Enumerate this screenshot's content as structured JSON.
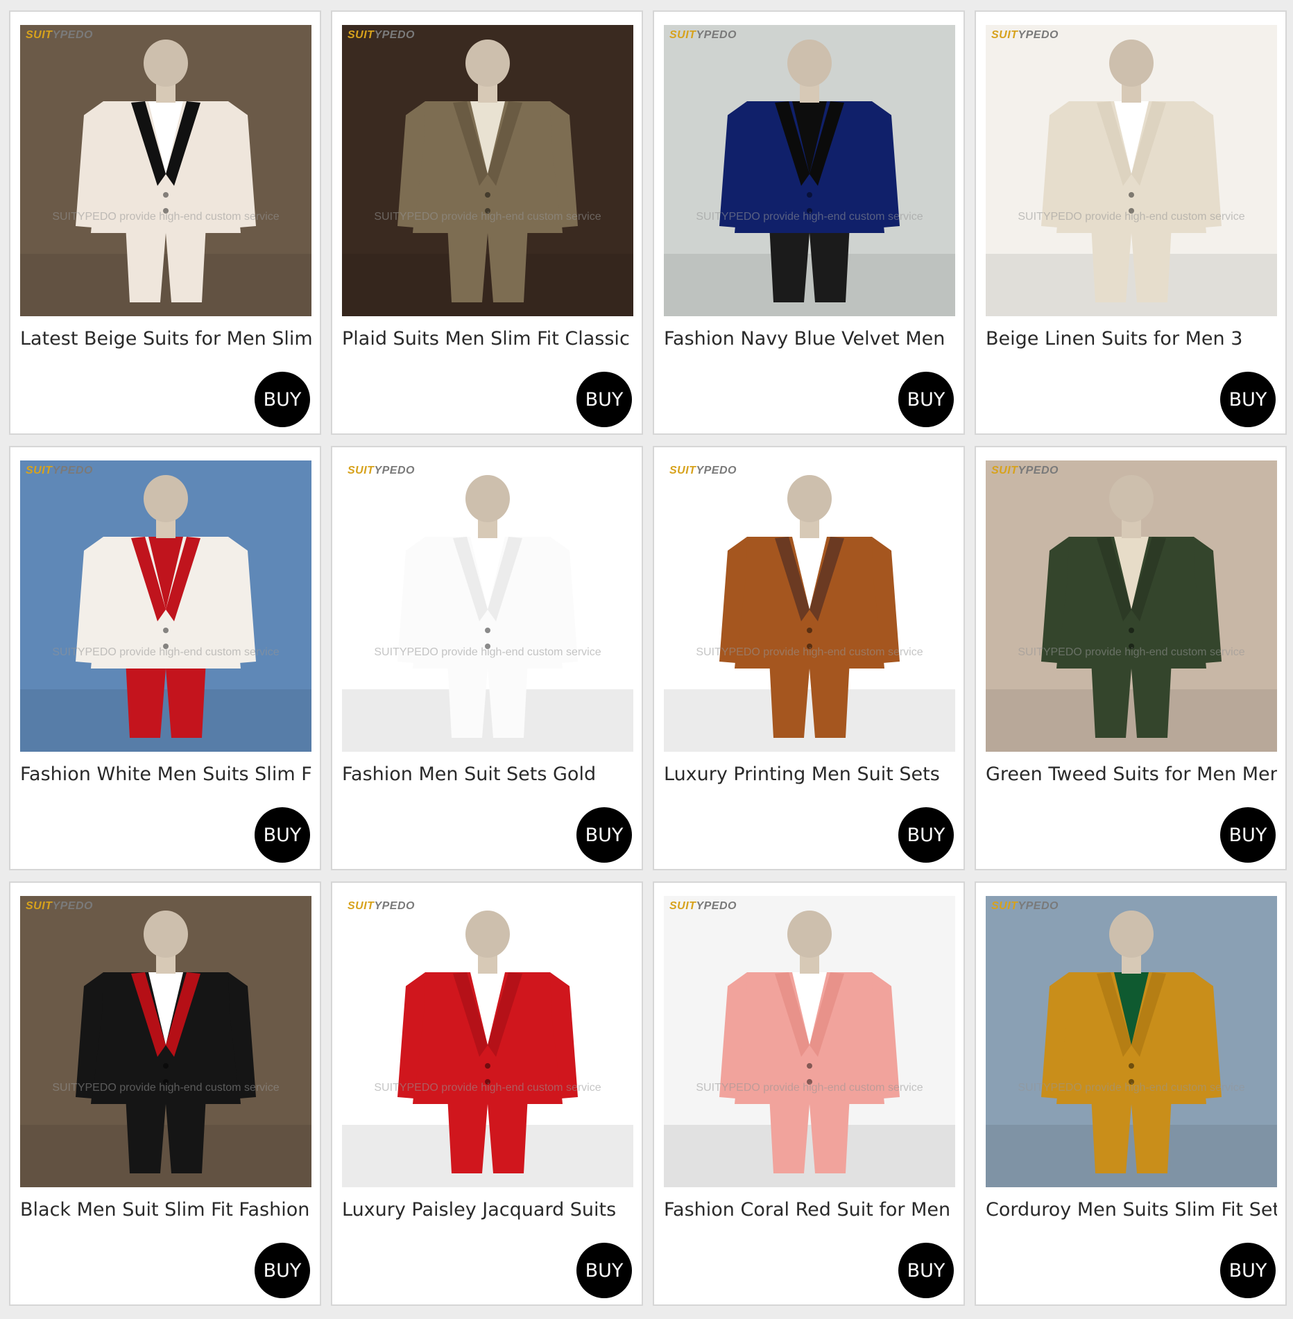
{
  "brand_logo": {
    "part1": "SUIT",
    "part2": "YPEDO"
  },
  "watermark": "SUITYPEDO provide high-end custom service",
  "buy_label": "BUY",
  "products": [
    {
      "title": "Latest Beige Suits for Men Slim",
      "jacket_color": "#efe6dc",
      "lapel_color": "#111111",
      "pants_color": "#efe6dc",
      "bg_color": "#6b5a48",
      "shirt_color": "#ffffff"
    },
    {
      "title": "Plaid Suits Men Slim Fit Classic",
      "jacket_color": "#7d6d52",
      "lapel_color": "#6a5b43",
      "pants_color": "#7d6d52",
      "bg_color": "#3a2a20",
      "shirt_color": "#e9e2d2"
    },
    {
      "title": "Fashion Navy Blue Velvet Men",
      "jacket_color": "#10206a",
      "lapel_color": "#0b0b0b",
      "pants_color": "#1b1b1b",
      "bg_color": "#cfd3d0",
      "shirt_color": "#0d0d0d"
    },
    {
      "title": "Beige Linen Suits for Men 3",
      "jacket_color": "#e6ddcc",
      "lapel_color": "#ddd3c0",
      "pants_color": "#e6ddcc",
      "bg_color": "#f4f1ec",
      "shirt_color": "#ffffff"
    },
    {
      "title": "Fashion White Men Suits Slim Fit",
      "jacket_color": "#f3efe9",
      "lapel_color": "#c0141d",
      "pants_color": "#c4141d",
      "bg_color": "#5f88b7",
      "shirt_color": "#c0141d"
    },
    {
      "title": "Fashion Men Suit Sets Gold",
      "jacket_color": "#fbfbfb",
      "lapel_color": "#ececec",
      "pants_color": "#fbfbfb",
      "bg_color": "#ffffff",
      "shirt_color": "#ffffff"
    },
    {
      "title": "Luxury Printing Men Suit Sets",
      "jacket_color": "#a5561f",
      "lapel_color": "#6b3a22",
      "pants_color": "#a5561f",
      "bg_color": "#ffffff",
      "shirt_color": "#ffffff"
    },
    {
      "title": "Green Tweed Suits for Men Men",
      "jacket_color": "#34452c",
      "lapel_color": "#2c3a25",
      "pants_color": "#34452c",
      "bg_color": "#c8b7a6",
      "shirt_color": "#e7dcc8"
    },
    {
      "title": "Black Men Suit Slim Fit Fashion",
      "jacket_color": "#151515",
      "lapel_color": "#b50f16",
      "pants_color": "#151515",
      "bg_color": "#6b5a48",
      "shirt_color": "#ffffff"
    },
    {
      "title": "Luxury Paisley Jacquard Suits",
      "jacket_color": "#d0161d",
      "lapel_color": "#b51118",
      "pants_color": "#d0161d",
      "bg_color": "#ffffff",
      "shirt_color": "#ffffff"
    },
    {
      "title": "Fashion Coral Red Suit for Men",
      "jacket_color": "#f1a39c",
      "lapel_color": "#e8928a",
      "pants_color": "#f1a39c",
      "bg_color": "#f5f5f5",
      "shirt_color": "#ffffff"
    },
    {
      "title": "Corduroy Men Suits Slim Fit Set",
      "jacket_color": "#c98e1a",
      "lapel_color": "#b57e14",
      "pants_color": "#c98e1a",
      "bg_color": "#8aa0b4",
      "shirt_color": "#0f5a30"
    }
  ]
}
